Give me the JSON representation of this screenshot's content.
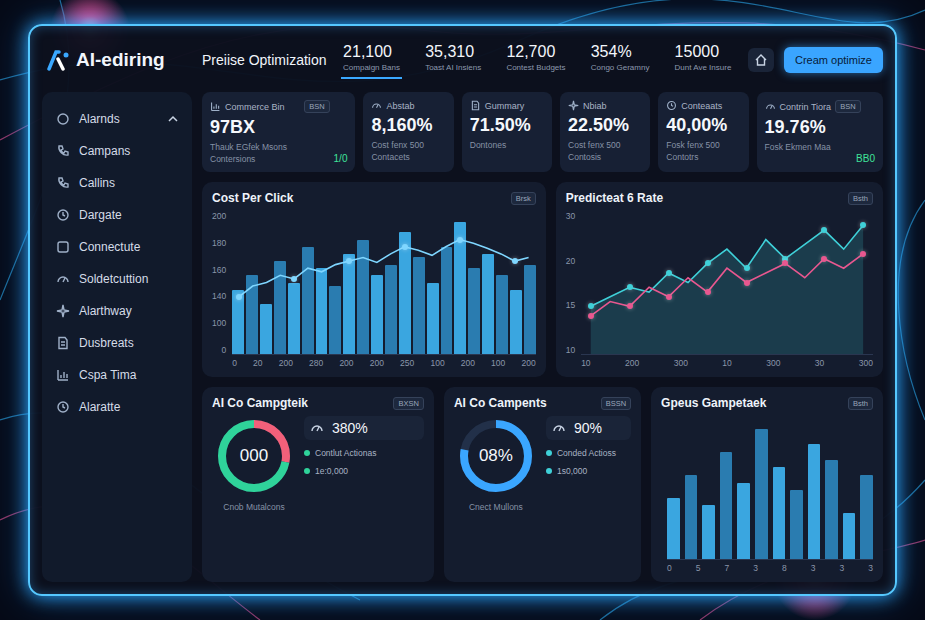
{
  "header": {
    "logo": "AI-ediring",
    "title": "Preiise Optimization",
    "button": "Cream optimize",
    "stats": [
      {
        "value": "21,100",
        "label": "Compaign Bans",
        "selected": true
      },
      {
        "value": "35,310",
        "label": "Toast AI Insiens",
        "selected": false
      },
      {
        "value": "12,700",
        "label": "Contest Budgets",
        "selected": false
      },
      {
        "value": "354%",
        "label": "Congo Geramny",
        "selected": false
      },
      {
        "value": "15000",
        "label": "Dunt Ave Insure",
        "selected": false
      }
    ]
  },
  "sidebar": {
    "header": {
      "label": "Alarnds",
      "expanded": true
    },
    "items": [
      "Campans",
      "Callins",
      "Dargate",
      "Connectute",
      "Soldetcuttion",
      "Alarthway",
      "Dusbreats",
      "Cspa Tima",
      "Alaratte"
    ]
  },
  "cards": [
    {
      "kind": "wide",
      "title": "Commerce Bin",
      "badge": "BSN",
      "value": "97BX",
      "lines": [
        "Thauk EGfek Msons",
        "Contersions"
      ],
      "delta": "1/0"
    },
    {
      "kind": "icon",
      "title": "Abstab",
      "value": "8,160%",
      "lines": [
        "Cost fenx 500",
        "Contacets"
      ]
    },
    {
      "kind": "icon",
      "title": "Gummary",
      "value": "71.50%",
      "lines": [
        "Dontones"
      ]
    },
    {
      "kind": "icon",
      "title": "Nbiab",
      "value": "22.50%",
      "lines": [
        "Cost fenx 500",
        "Contosis"
      ]
    },
    {
      "kind": "icon",
      "title": "Conteaats",
      "value": "40,00%",
      "lines": [
        "Fosk fenx 500",
        "Contotrs"
      ]
    },
    {
      "kind": "wide",
      "title": "Contrin Tiora",
      "badge": "BSN",
      "value": "19.76%",
      "lines": [
        "Fosk Ekmen Maa"
      ],
      "delta": "BB0"
    }
  ],
  "charts": {
    "cost_per_click": {
      "title": "Cost Per Click",
      "badge": "Brsk",
      "y_ticks": [
        "200",
        "180",
        "160",
        "140",
        "100",
        "0"
      ],
      "x_ticks": [
        "0",
        "20",
        "200",
        "280",
        "200",
        "200",
        "250",
        "100",
        "200",
        "100",
        "200"
      ],
      "bars": [
        90,
        110,
        70,
        130,
        100,
        150,
        120,
        95,
        140,
        160,
        110,
        125,
        170,
        135,
        100,
        150,
        185,
        120,
        140,
        110,
        90,
        125
      ],
      "line": [
        80,
        95,
        100,
        110,
        105,
        120,
        115,
        125,
        130,
        135,
        128,
        140,
        150,
        145,
        138,
        150,
        160,
        155,
        148,
        140,
        130,
        135
      ]
    },
    "predicted": {
      "title": "Predicteat 6 Rate",
      "badge": "Bsth",
      "y_ticks": [
        "30",
        "20",
        "15",
        "10"
      ],
      "x_ticks": [
        "10",
        "200",
        "300",
        "10",
        "300",
        "30",
        "300"
      ],
      "series": [
        {
          "color": "#3fd0d8",
          "values": [
            10,
            12,
            14,
            13,
            17,
            15,
            19,
            22,
            18,
            24,
            20,
            23,
            26,
            22,
            27
          ]
        },
        {
          "color": "#e8578f",
          "values": [
            8,
            11,
            10,
            14,
            12,
            16,
            13,
            18,
            15,
            17,
            19,
            16,
            20,
            18,
            21
          ]
        }
      ]
    },
    "groups": {
      "title": "Gpeus Gampetaek",
      "badge": "Bsth",
      "x_ticks": [
        "0",
        "5",
        "7",
        "3",
        "8",
        "3",
        "3",
        "3"
      ],
      "bars": [
        40,
        55,
        35,
        70,
        50,
        85,
        60,
        45,
        75,
        65,
        30,
        55
      ]
    }
  },
  "donuts": [
    {
      "title": "AI Co Campgteik",
      "badge": "BXSN",
      "center": "000",
      "segments": [
        {
          "level": 0.28,
          "color": "#f2607a"
        },
        {
          "level": 0.72,
          "color": "#2fd39a"
        }
      ],
      "stat": "380%",
      "legend": [
        {
          "label": "Contlut Actionas",
          "color": "#2fd39a"
        },
        {
          "label": "1e:0,000",
          "color": "#2fd39a"
        }
      ],
      "footer": "Cnob Mutalcons"
    },
    {
      "title": "AI Co Campents",
      "badge": "BSSN",
      "center": "08%",
      "segments": [
        {
          "level": 0.78,
          "color": "#3aa6ff"
        }
      ],
      "stat": "90%",
      "legend": [
        {
          "label": "Conded Actioss",
          "color": "#3fd0d8"
        },
        {
          "label": "1s0,000",
          "color": "#3fd0d8"
        }
      ],
      "footer": "Cnect Mullons"
    }
  ]
}
